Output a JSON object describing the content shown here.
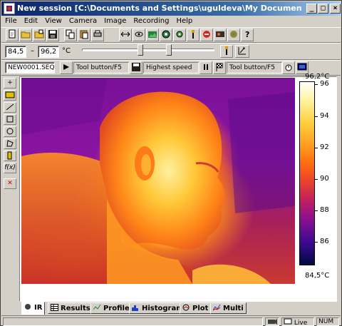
{
  "window": {
    "title": "New session [C:\\Documents and Settings\\uguldeva\\My Documents\\ThermaCAM Researcher...",
    "controls": [
      "_",
      "□",
      "×"
    ]
  },
  "menu": [
    "File",
    "Edit",
    "View",
    "Camera",
    "Image",
    "Recording",
    "Help"
  ],
  "range": {
    "min": "84,5",
    "dash": "–",
    "max": "96,2",
    "unit": "°C"
  },
  "recording_bar": {
    "file": "NEW0001.SEQ",
    "tool_button_1": "Tool button/F5",
    "speed": "Highest speed",
    "tool_button_2": "Tool button/F5"
  },
  "scale": {
    "max_label": "96,2°C",
    "min_label": "84,5°C",
    "ticks": [
      "96",
      "94",
      "92",
      "90",
      "88",
      "86"
    ],
    "tick_values": [
      96,
      94,
      92,
      90,
      88,
      86
    ]
  },
  "tabs": [
    "IR",
    "Results",
    "Profile",
    "Histogram",
    "Plot",
    "Multi"
  ],
  "status": {
    "live": "Live",
    "num": "NUM"
  },
  "colors": {
    "titlebar": "#0a246a",
    "face_hot": "#ffd24a",
    "background_cold": "#7a1098"
  },
  "icons": {
    "toolbar1": [
      "new-icon",
      "open-icon",
      "open-folder-icon",
      "save-icon",
      "copy-icon",
      "paste-icon",
      "print-icon",
      "zoom-icon",
      "camera-icon",
      "palette-icon",
      "settings-icon",
      "target-icon",
      "gear-icon",
      "focus-icon",
      "stop-icon",
      "record-icon",
      "camera-cassette-icon",
      "help-icon"
    ]
  }
}
